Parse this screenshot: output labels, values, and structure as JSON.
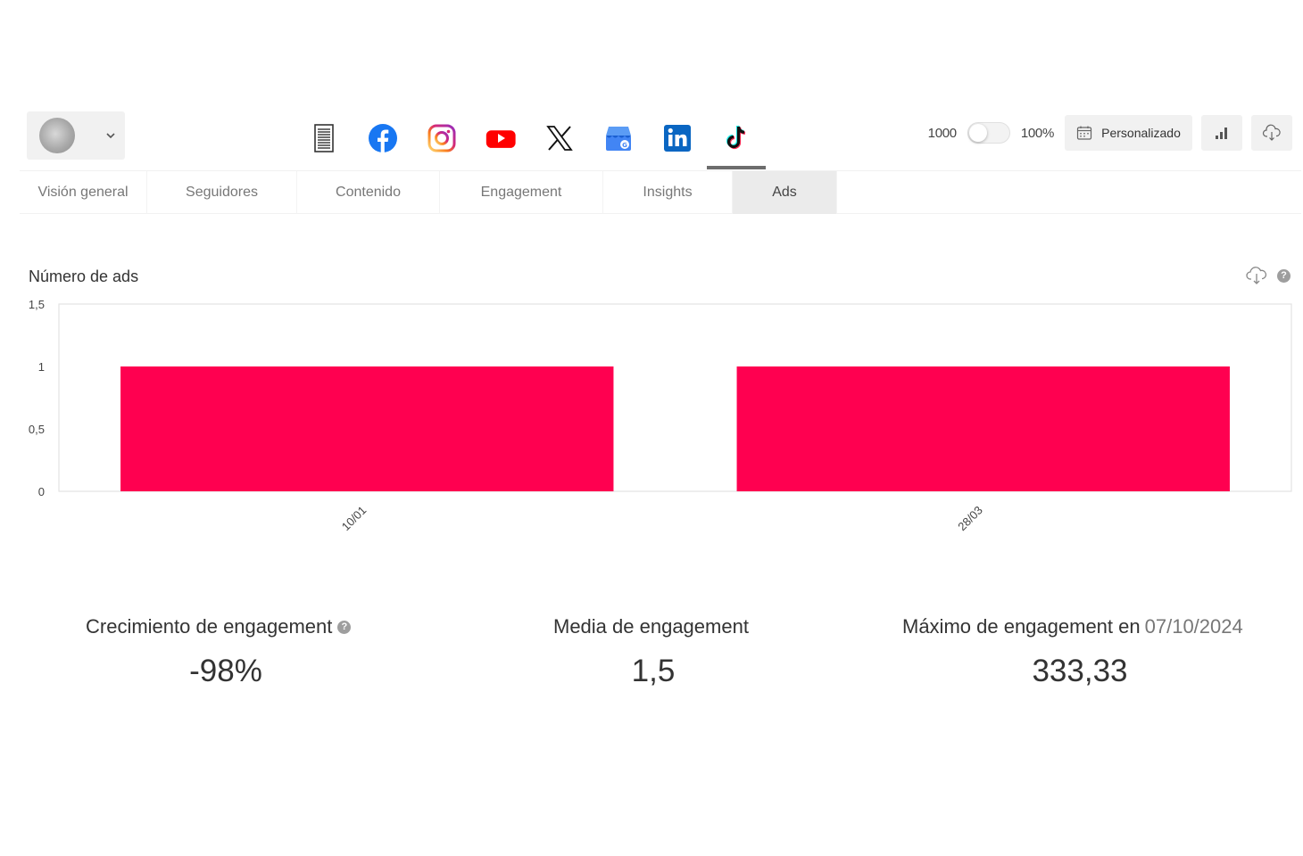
{
  "header": {
    "networks": [
      {
        "name": "report",
        "icon": "report-icon"
      },
      {
        "name": "facebook",
        "icon": "facebook-icon"
      },
      {
        "name": "instagram",
        "icon": "instagram-icon"
      },
      {
        "name": "youtube",
        "icon": "youtube-icon"
      },
      {
        "name": "x",
        "icon": "x-icon"
      },
      {
        "name": "google-business",
        "icon": "google-business-icon"
      },
      {
        "name": "linkedin",
        "icon": "linkedin-icon"
      },
      {
        "name": "tiktok",
        "icon": "tiktok-icon",
        "active": true
      }
    ],
    "toggle_left_label": "1000",
    "toggle_right_label": "100%",
    "date_button_label": "Personalizado"
  },
  "tabs": [
    {
      "label": "Visión general"
    },
    {
      "label": "Seguidores"
    },
    {
      "label": "Contenido"
    },
    {
      "label": "Engagement"
    },
    {
      "label": "Insights"
    },
    {
      "label": "Ads",
      "active": true
    }
  ],
  "chart": {
    "title": "Número de ads"
  },
  "chart_data": {
    "type": "bar",
    "title": "Número de ads",
    "categories": [
      "10/01",
      "28/03"
    ],
    "values": [
      1,
      1
    ],
    "ylim": [
      0,
      1.5
    ],
    "yticks": [
      "0",
      "0,5",
      "1",
      "1,5"
    ],
    "xlabel": "",
    "ylabel": "",
    "bar_color": "#ff0050",
    "grid": false
  },
  "stats": {
    "growth": {
      "label": "Crecimiento de engagement",
      "value": "-98%"
    },
    "average": {
      "label": "Media de engagement",
      "value": "1,5"
    },
    "max": {
      "label": "Máximo de engagement en",
      "date": "07/10/2024",
      "value": "333,33"
    }
  },
  "colors": {
    "accent": "#ff0050",
    "tab_active_bg": "#ebebeb"
  }
}
